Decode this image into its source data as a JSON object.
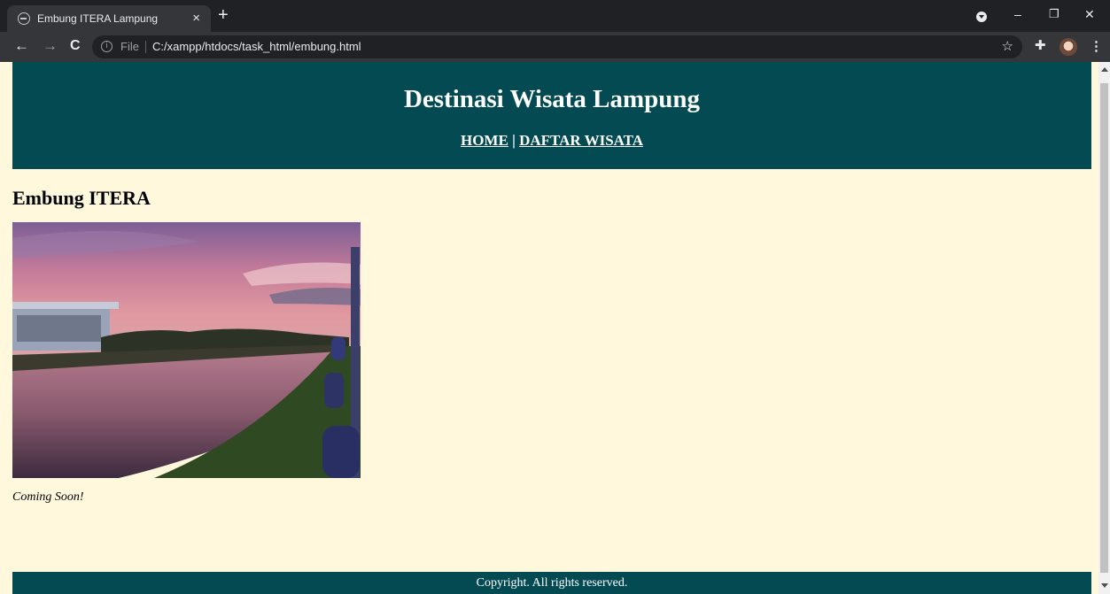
{
  "browser": {
    "tab_title": "Embung ITERA Lampung",
    "tab_close": "×",
    "new_tab": "+",
    "back": "←",
    "forward": "→",
    "reload": "C",
    "file_label": "File",
    "url": "C:/xampp/htdocs/task_html/embung.html",
    "bookmark_star": "☆",
    "window_minimize": "–",
    "window_restore": "❐",
    "window_close": "✕",
    "extensions": "✚",
    "menu": "⋮"
  },
  "page": {
    "site_title": "Destinasi Wisata Lampung",
    "nav": {
      "home": "HOME",
      "separator": " | ",
      "daftar": "DAFTAR WISATA"
    },
    "heading": "Embung ITERA",
    "photo_subject": "sunset over Embung ITERA reservoir",
    "caption": "Coming Soon!",
    "footer": "Copyright. All rights reserved."
  },
  "colors": {
    "header_bg": "#034a53",
    "page_bg": "#fff8dd",
    "chrome_dark": "#202124",
    "chrome_toolbar": "#35363a"
  }
}
